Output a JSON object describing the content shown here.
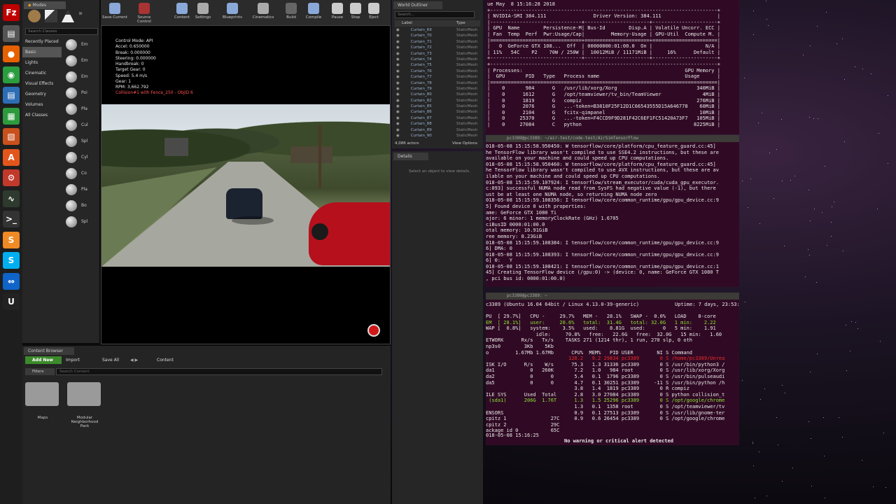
{
  "taskbar": {
    "icons": [
      {
        "name": "filezilla-icon",
        "glyph": "Fz",
        "color": "#bf0000"
      },
      {
        "name": "files-icon",
        "glyph": "▤",
        "color": "#555"
      },
      {
        "name": "firefox-icon",
        "glyph": "●",
        "color": "#e66000"
      },
      {
        "name": "chrome-icon",
        "glyph": "◉",
        "color": "#2a9d3f"
      },
      {
        "name": "writer-icon",
        "glyph": "▤",
        "color": "#2d6db5"
      },
      {
        "name": "calc-icon",
        "glyph": "▦",
        "color": "#2d9a3d"
      },
      {
        "name": "impress-icon",
        "glyph": "▧",
        "color": "#c8501c"
      },
      {
        "name": "software-center-icon",
        "glyph": "A",
        "color": "#e2551b"
      },
      {
        "name": "settings-icon",
        "glyph": "⚙",
        "color": "#c0392b"
      },
      {
        "name": "system-monitor-icon",
        "glyph": "∿",
        "color": "#2f3a2f"
      },
      {
        "name": "terminal-icon",
        "glyph": ">_",
        "color": "#333"
      },
      {
        "name": "sublime-icon",
        "glyph": "S",
        "color": "#f08a24"
      },
      {
        "name": "skype-icon",
        "glyph": "S",
        "color": "#00aff0"
      },
      {
        "name": "teamviewer-icon",
        "glyph": "⇔",
        "color": "#0e64c8"
      },
      {
        "name": "unreal-icon",
        "glyph": "U",
        "color": "#222"
      }
    ]
  },
  "modes": {
    "tab": "Modes",
    "search_placeholder": "Search Classes",
    "categories": [
      "Recently Placed",
      "Basic",
      "Lights",
      "Cinematic",
      "Visual Effects",
      "Geometry",
      "Volumes",
      "All Classes"
    ],
    "active_category": "Basic",
    "place_items": [
      "Em",
      "Em",
      "Em",
      "Poi",
      "Pla",
      "Cul",
      "Spl",
      "Cyl",
      "Co",
      "Pla",
      "Bo",
      "Spl"
    ]
  },
  "toolbar": {
    "buttons": [
      {
        "name": "save-current-button",
        "label": "Save Current",
        "color": "#8aa8d8"
      },
      {
        "name": "source-control-button",
        "label": "Source Control",
        "color": "#a33"
      },
      {
        "name": "content-button",
        "label": "Content",
        "color": "#8aa8d8"
      },
      {
        "name": "settings-button",
        "label": "Settings",
        "color": "#aaa"
      },
      {
        "name": "blueprints-button",
        "label": "Blueprints",
        "color": "#8aa8d8"
      },
      {
        "name": "cinematics-button",
        "label": "Cinematics",
        "color": "#aaa"
      },
      {
        "name": "build-button",
        "label": "Build",
        "color": "#666"
      },
      {
        "name": "compile-button",
        "label": "Compile",
        "color": "#8aa8d8"
      },
      {
        "name": "pause-button",
        "label": "Pause",
        "color": "#ccc"
      },
      {
        "name": "stop-button",
        "label": "Stop",
        "color": "#ccc"
      },
      {
        "name": "eject-button",
        "label": "Eject",
        "color": "#ccc"
      }
    ]
  },
  "viewport": {
    "hud": [
      "Control Mode: API",
      "Accel: 0.650000",
      "Break: 0.000000",
      "Steering: 0.000000",
      "Handbreak: 0",
      "Target Gear: 0",
      "Speed: 5.4 m/s",
      "Gear: 1",
      "RPM: 3,662.792"
    ],
    "collision": "Collision#1 with Fence_250 - ObjID 6"
  },
  "outliner": {
    "tab": "World Outliner",
    "search_placeholder": "Search...",
    "col_label": "Label",
    "col_type": "Type",
    "rows": [
      "Curtain_69",
      "Curtain_70",
      "Curtain_71",
      "Curtain_72",
      "Curtain_73",
      "Curtain_74",
      "Curtain_75",
      "Curtain_76",
      "Curtain_77",
      "Curtain_78",
      "Curtain_79",
      "Curtain_80",
      "Curtain_82",
      "Curtain_85",
      "Curtain_86",
      "Curtain_87",
      "Curtain_88",
      "Curtain_89",
      "Curtain_90"
    ],
    "row_type": "StaticMesh",
    "actors": "4,086 actors",
    "view_options": "View Options"
  },
  "details": {
    "tab": "Details",
    "empty": "Select an object to view details."
  },
  "content_browser": {
    "tab": "Content Browser",
    "add_new": "Add New",
    "import": "Import",
    "save_all": "Save All",
    "path": "Content",
    "filters": "Filters",
    "search_placeholder": "Search Content",
    "folders": [
      "Maps",
      "Modular Neighborhood Pack"
    ]
  },
  "nvidia": {
    "lines": [
      "ue May  8 15:16:28 2018",
      "+-----------------------------------------------------------------------------+",
      "| NVIDIA-SMI 384.111                Driver Version: 384.111                   |",
      "|-------------------------------+----------------------+----------------------+",
      "| GPU  Name        Persistence-M| Bus-Id        Disp.A | Volatile Uncorr. ECC |",
      "| Fan  Temp  Perf  Pwr:Usage/Cap|         Memory-Usage | GPU-Util  Compute M. |",
      "|===============================+======================+======================|",
      "|   0  GeForce GTX 108...  Off  | 00000000:01:00.0  On |                  N/A |",
      "| 11%   54C    P2    70W / 250W |  10012MiB / 11171MiB |     16%      Default |",
      "+-------------------------------+----------------------+----------------------+",
      "",
      "+-----------------------------------------------------------------------------+",
      "| Processes:                                                       GPU Memory |",
      "|  GPU       PID   Type   Process name                             Usage      |",
      "|=============================================================================|",
      "|    0       984      G   /usr/lib/xorg/Xorg                           340MiB |",
      "|    0      1612      G   /opt/teamviewer/tv_bin/TeamViewer              4MiB |",
      "|    0      1819      G   compiz                                       276MiB |",
      "|    0      2076      G   ...-token=B3810F25F12D1C66543555D15A646778    60MiB |",
      "|    0      2104      G   fcitx-qimpanel                                10MiB |",
      "|    0     25370      G   ...-token=F4CCD9F9D281F42C6EF1FC51420A73F7   105MiB |",
      "|    0     27084      C   python                                      8225MiB |"
    ]
  },
  "tf_terminal": {
    "title": "pc3389@pc3389: ~/air-test/code-test/AirSimTensorFlow",
    "lines": [
      "018-05-08 15:15:58.950450: W tensorflow/core/platform/cpu_feature_guard.cc:45]",
      "he TensorFlow library wasn't compiled to use SSE4.2 instructions, but these are",
      "available on your machine and could speed up CPU computations.",
      "018-05-08 15:15:58.950460: W tensorflow/core/platform/cpu_feature_guard.cc:45]",
      "he TensorFlow library wasn't compiled to use AVX instructions, but these are av",
      "ilable on your machine and could speed up CPU computations.",
      "018-05-08 15:15:59.107924: I tensorflow/stream_executor/cuda/cuda_gpu_executor.",
      "c:893] successful NUMA node read from SysFS had negative value (-1), but there",
      "ust be at least one NUMA node, so returning NUMA node zero",
      "018-05-08 15:15:59.108356: I tensorflow/core/common_runtime/gpu/gpu_device.cc:9",
      "5] Found device 0 with properties:",
      "ame: GeForce GTX 1080 Ti",
      "ajor: 6 minor: 1 memoryClockRate (GHz) 1.6705",
      "ciBusID 0000:01:00.0",
      "otal memory: 10.91GiB",
      "ree memory: 8.23GiB",
      "018-05-08 15:15:59.108384: I tensorflow/core/common_runtime/gpu/gpu_device.cc:9",
      "6] DMA: 0",
      "018-05-08 15:15:59.108393: I tensorflow/core/common_runtime/gpu/gpu_device.cc:9",
      "6] 0:   Y",
      "018-05-08 15:15:59.108421: I tensorflow/core/common_runtime/gpu/gpu_device.cc:1",
      "45] Creating TensorFlow device (/gpu:0) -> (device: 0, name: GeForce GTX 1080 T",
      ", pci bus id: 0000:01:00.0)"
    ]
  },
  "glances": {
    "title": "pc3389@pc3389: ~",
    "header_left": "c3389 (Ubuntu 16.04 64bit / Linux 4.13.0-39-generic)",
    "uptime": "Uptime: 7 days, 23:53:28",
    "alert": "No warning or critical alert detected",
    "footer_time": "018-05-08 15:16:25",
    "colors": {
      "green_bg": "#4e9a06",
      "red": "#ef2929",
      "magenta": "#c061c0",
      "green": "#8ae234",
      "blue": "#729fcf"
    }
  }
}
